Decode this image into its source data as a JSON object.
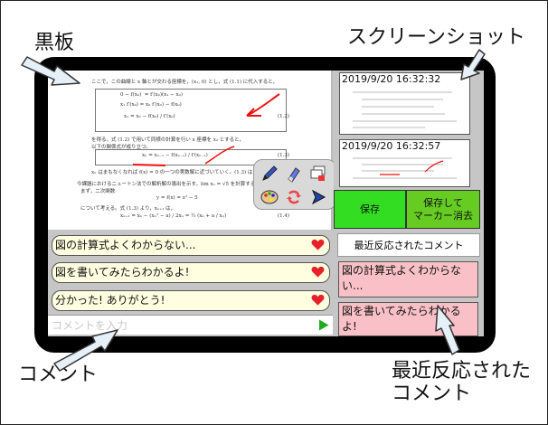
{
  "callouts": {
    "blackboard": "黒板",
    "screenshot": "スクリーンショット",
    "comment": "コメント",
    "recent": "最近反応された\nコメント"
  },
  "doc": {
    "intro": "ここで，この曲線と x 軸とが交わる座標を，(x₁, 0) とし，式 (1.1) に代入すると，",
    "eq1_label": "(1.2)",
    "eq2_label": "(1.3)",
    "after_eq": "を得る。式 (1.2) で用いて同様の計算を行い x 座標を x₂ とすると，",
    "closing": "以下の関係式が成り立つ。",
    "conv": "xₙ はまもなくなれば f(x) = 0 の一つの実数解に近づいていく。(1.3) は，",
    "example": "今課題におけるニュートン法での解析解の導出を示す。lim xₙ = √5 を計算する。",
    "func_intro": "まず，二次関数",
    "func": "y = f(x) = x² − 5",
    "iter_intro": "について考える。式 (1.3) より，xₙ₊₁ は，",
    "eq4_label": "(1.4)"
  },
  "comments": [
    {
      "text": "図の計算式よくわからない..."
    },
    {
      "text": "図を書いてみたらわかるよ!"
    },
    {
      "text": "分かった! ありがとう!"
    }
  ],
  "comment_input": {
    "placeholder": "コメントを入力",
    "value": ""
  },
  "screenshots": [
    {
      "timestamp": "2019/9/20 16:32:32"
    },
    {
      "timestamp": "2019/9/20 16:32:57"
    }
  ],
  "buttons": {
    "save": "保存",
    "save_clear": "保存して\nマーカー消去"
  },
  "recent": {
    "title": "最近反応されたコメント",
    "items": [
      {
        "text": "図の計算式よくわからない..."
      },
      {
        "text": "図を書いてみたらわかるよ!"
      }
    ]
  },
  "colors": {
    "save_green": "#33dd22",
    "save_clear_green": "#66cc22",
    "heart_red": "#e8202a",
    "comment_bg": "#fffee0",
    "recent_bg": "#f9c1c7",
    "marker_red": "#ee1111",
    "send_green": "#22aa22"
  }
}
